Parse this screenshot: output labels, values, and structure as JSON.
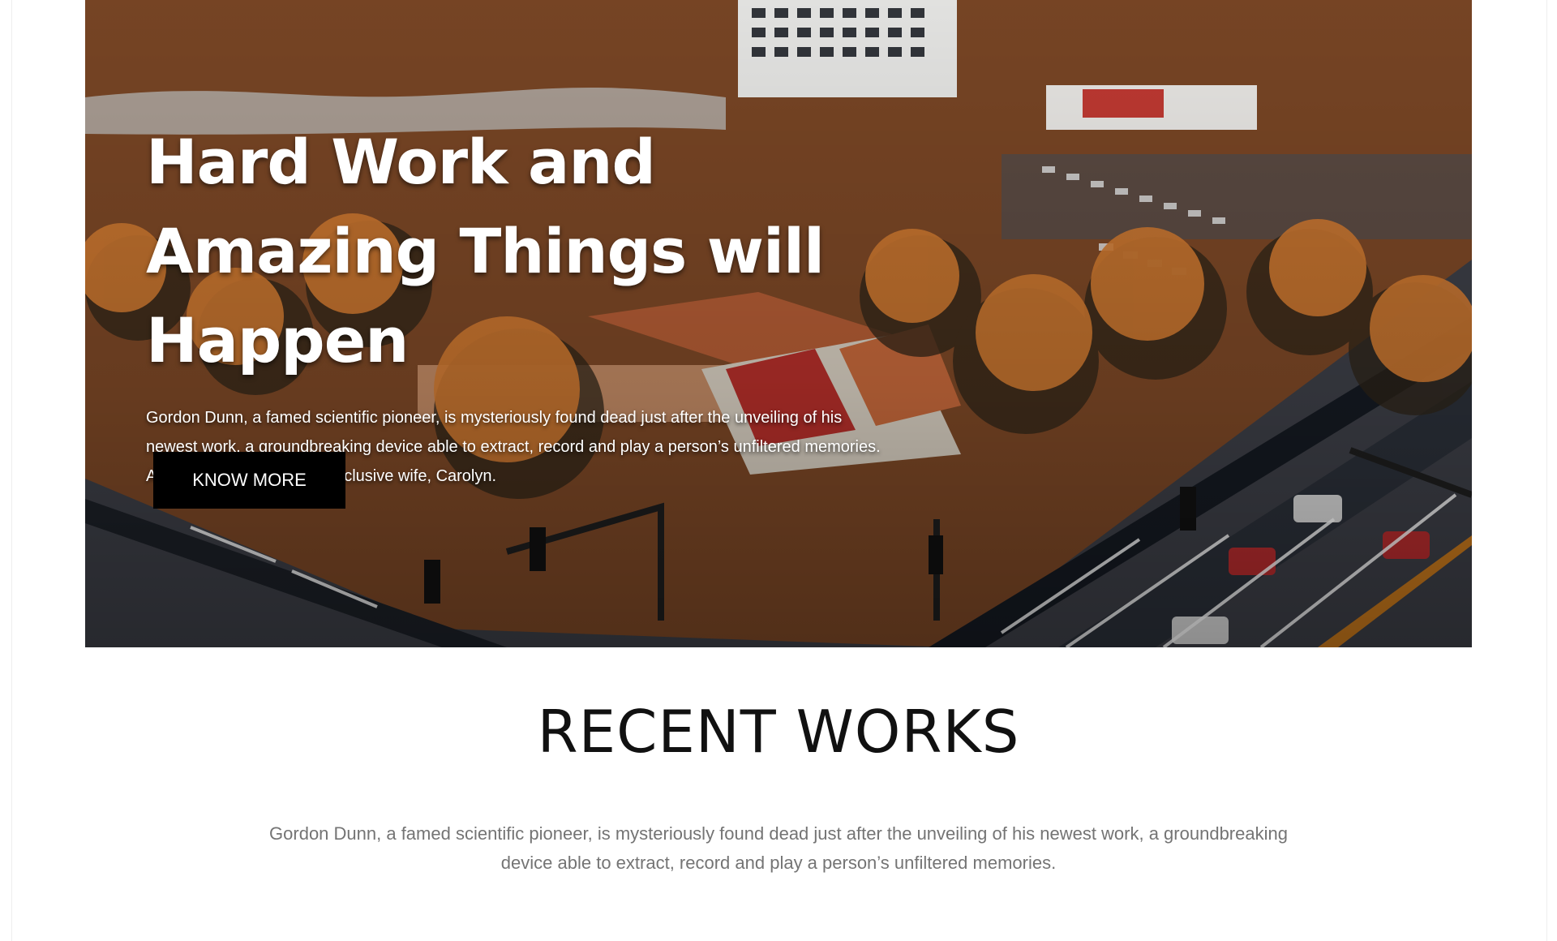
{
  "hero": {
    "title": "Hard Work and Amazing Things will Happen",
    "text": "Gordon Dunn, a famed scientific pioneer, is mysteriously found dead just after the unveiling of his newest work, a groundbreaking device able to extract, record and play a person’s unfiltered memories. After his death, Gordon’s reclusive wife, Carolyn.",
    "button_label": "KNOW MORE",
    "image_description": "aerial city view with buildings, trees, roads, cars and people"
  },
  "recent_works": {
    "title": "RECENT WORKS",
    "text": "Gordon Dunn, a famed scientific pioneer, is mysteriously found dead just after the unveiling of his newest work, a groundbreaking device able to extract, record and play a person’s unfiltered memories."
  },
  "colors": {
    "button": "#000000",
    "title": "#111111",
    "body_text": "#747474",
    "white": "#ffffff"
  }
}
